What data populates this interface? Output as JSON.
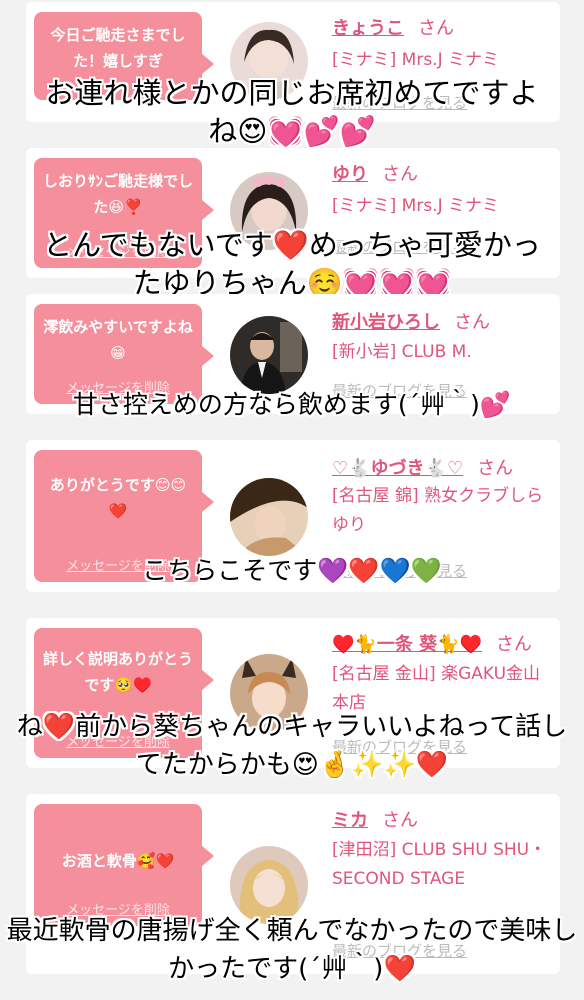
{
  "colors": {
    "bubble": "#f58f9b",
    "accent": "#e0557a",
    "card": "#ffffff",
    "background": "#f2f2f2"
  },
  "delete_label": "メッセージを削除",
  "blog_label": "最新のブログを見る",
  "entries": [
    {
      "message": "今日ご馳走さまでした！嬉しすぎ",
      "name": "きょうこ",
      "suffix": "さん",
      "shop": "[ミナミ] Mrs.J ミナミ",
      "caption": "お連れ様とかの同じお席初めてですよね😍💓💕💕"
    },
    {
      "message": "しおりｻﾝご馳走様でした😆❣️",
      "name": "ゆり",
      "suffix": "さん",
      "shop": "[ミナミ] Mrs.J ミナミ",
      "caption": "とんでもないです❤️めっちゃ可愛かったゆりちゃん☺️💓💓💓"
    },
    {
      "message": "澪飲みやすいですよね😁",
      "name": "新小岩ひろし",
      "suffix": "さん",
      "shop": "[新小岩] CLUB M.",
      "caption": "甘さ控えめの方なら飲めます(´艸｀)💕"
    },
    {
      "message": "ありがとうです😊😊❤️",
      "name": "♡🐇ゆづき🐇♡",
      "suffix": "さん",
      "shop": "[名古屋 錦] 熟女クラブしらゆり",
      "caption": "こちらこそです💜❤️💙💚"
    },
    {
      "message": "詳しく説明ありがとうです🥺♥️",
      "name": "♥️🐈一条 葵🐈♥️",
      "suffix": "さん",
      "shop": "[名古屋 金山] 楽GAKU金山本店",
      "caption": "ね❤️前から葵ちゃんのキャラいいよねって話してたからかも😍🤞✨✨❤️"
    },
    {
      "message": "お酒と軟骨🥰❤️",
      "name": "ミカ",
      "suffix": "さん",
      "shop": "[津田沼] CLUB SHU SHU・SECOND STAGE",
      "caption": "最近軟骨の唐揚げ全く頼んでなかったので美味しかったです(´艸｀)❤️"
    }
  ]
}
